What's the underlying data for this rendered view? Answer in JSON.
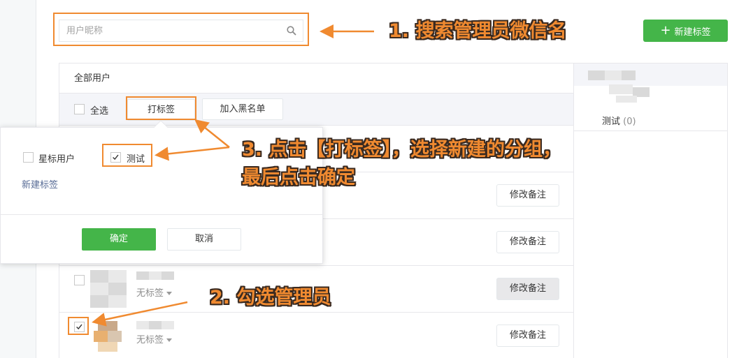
{
  "search": {
    "placeholder": "用户昵称"
  },
  "new_tag_button": {
    "label": "新建标签",
    "icon": "plus-icon"
  },
  "user_panel": {
    "title": "全部用户",
    "select_all_label": "全选",
    "tag_button_label": "打标签",
    "blacklist_button_label": "加入黑名单",
    "remark_button_label": "修改备注",
    "users": [
      {
        "tag_label": "无标签",
        "checked": false
      },
      {
        "tag_label": "无标签",
        "checked": true
      }
    ]
  },
  "tag_sidebar": {
    "tags": [
      {
        "name": "测试",
        "count": "(0)"
      }
    ]
  },
  "tag_popover": {
    "options": [
      {
        "label": "星标用户",
        "checked": false
      },
      {
        "label": "测试",
        "checked": true
      }
    ],
    "new_tag_link": "新建标签",
    "confirm_label": "确定",
    "cancel_label": "取消"
  },
  "annotations": {
    "step1": "1. 搜索管理员微信名",
    "step2": "2. 勾选管理员",
    "step3_line1": "3. 点击【打标签】，选择新建的分组，",
    "step3_line2": "最后点击确定"
  },
  "colors": {
    "accent_green": "#44b549",
    "annotation_orange": "#f08a30"
  }
}
